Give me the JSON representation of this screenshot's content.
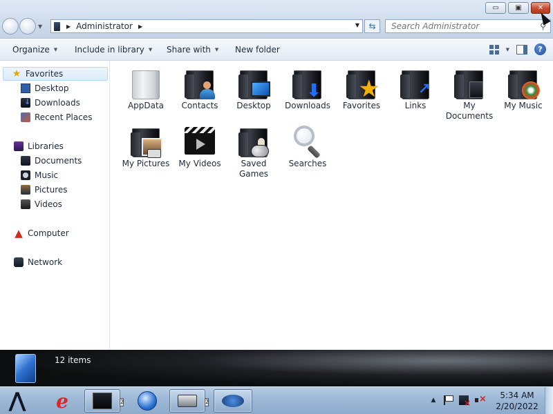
{
  "window": {
    "controls": {
      "minimize": "▭",
      "maximize": "▣",
      "close": "✕"
    }
  },
  "address": {
    "breadcrumb": [
      "Administrator"
    ],
    "search_placeholder": "Search Administrator"
  },
  "toolbar": {
    "organize": "Organize",
    "include": "Include in library",
    "share": "Share with",
    "new_folder": "New folder"
  },
  "nav": {
    "favorites": {
      "label": "Favorites",
      "items": [
        "Desktop",
        "Downloads",
        "Recent Places"
      ]
    },
    "libraries": {
      "label": "Libraries",
      "items": [
        "Documents",
        "Music",
        "Pictures",
        "Videos"
      ]
    },
    "computer": "Computer",
    "network": "Network"
  },
  "items": [
    {
      "label": "AppData",
      "icon": "folder-light"
    },
    {
      "label": "Contacts",
      "icon": "contacts-folder-icon"
    },
    {
      "label": "Desktop",
      "icon": "desktop-folder-icon"
    },
    {
      "label": "Downloads",
      "icon": "downloads-folder-icon"
    },
    {
      "label": "Favorites",
      "icon": "favorites-folder-icon"
    },
    {
      "label": "Links",
      "icon": "links-folder-icon"
    },
    {
      "label": "My Documents",
      "icon": "documents-folder-icon"
    },
    {
      "label": "My Music",
      "icon": "music-folder-icon"
    },
    {
      "label": "My Pictures",
      "icon": "pictures-folder-icon"
    },
    {
      "label": "My Videos",
      "icon": "videos-folder-icon"
    },
    {
      "label": "Saved Games",
      "icon": "games-folder-icon"
    },
    {
      "label": "Searches",
      "icon": "searches-icon"
    }
  ],
  "status": {
    "count": "12 items"
  },
  "taskbar": {
    "ie_glyph": "e",
    "start_glyph": "⋀",
    "clock": {
      "time": "5:34 AM",
      "date": "2/20/2022"
    },
    "badges": [
      "2",
      "2"
    ]
  }
}
